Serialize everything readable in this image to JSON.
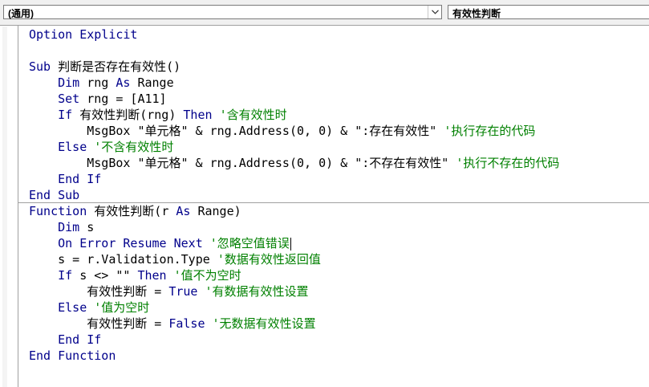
{
  "toolbar": {
    "object_combo": "(通用)",
    "procedure_combo": "有效性判断"
  },
  "code_lines": [
    [
      {
        "t": "kw",
        "v": "Option Explicit"
      }
    ],
    [],
    [
      {
        "t": "kw",
        "v": "Sub "
      },
      {
        "t": "tx",
        "v": "判断是否存在有效性()"
      }
    ],
    [
      {
        "t": "tx",
        "v": "    "
      },
      {
        "t": "kw",
        "v": "Dim "
      },
      {
        "t": "tx",
        "v": "rng "
      },
      {
        "t": "kw",
        "v": "As "
      },
      {
        "t": "tx",
        "v": "Range"
      }
    ],
    [
      {
        "t": "tx",
        "v": "    "
      },
      {
        "t": "kw",
        "v": "Set "
      },
      {
        "t": "tx",
        "v": "rng = [A11]"
      }
    ],
    [
      {
        "t": "tx",
        "v": "    "
      },
      {
        "t": "kw",
        "v": "If "
      },
      {
        "t": "tx",
        "v": "有效性判断(rng) "
      },
      {
        "t": "kw",
        "v": "Then "
      },
      {
        "t": "cm",
        "v": "'含有效性时"
      }
    ],
    [
      {
        "t": "tx",
        "v": "        MsgBox \"单元格\" & rng.Address(0, 0) & \":存在有效性\" "
      },
      {
        "t": "cm",
        "v": "'执行存在的代码"
      }
    ],
    [
      {
        "t": "tx",
        "v": "    "
      },
      {
        "t": "kw",
        "v": "Else "
      },
      {
        "t": "cm",
        "v": "'不含有效性时"
      }
    ],
    [
      {
        "t": "tx",
        "v": "        MsgBox \"单元格\" & rng.Address(0, 0) & \":不存在有效性\" "
      },
      {
        "t": "cm",
        "v": "'执行不存在的代码"
      }
    ],
    [
      {
        "t": "tx",
        "v": "    "
      },
      {
        "t": "kw",
        "v": "End If"
      }
    ],
    [
      {
        "t": "kw",
        "v": "End Sub"
      }
    ],
    [
      {
        "t": "kw",
        "v": "Function "
      },
      {
        "t": "tx",
        "v": "有效性判断(r "
      },
      {
        "t": "kw",
        "v": "As "
      },
      {
        "t": "tx",
        "v": "Range)"
      }
    ],
    [
      {
        "t": "tx",
        "v": "    "
      },
      {
        "t": "kw",
        "v": "Dim "
      },
      {
        "t": "tx",
        "v": "s"
      }
    ],
    [
      {
        "t": "tx",
        "v": "    "
      },
      {
        "t": "kw",
        "v": "On Error Resume Next "
      },
      {
        "t": "cm",
        "v": "'忽略空值错误"
      }
    ],
    [
      {
        "t": "tx",
        "v": "    s = r.Validation.Type "
      },
      {
        "t": "cm",
        "v": "'数据有效性返回值"
      }
    ],
    [
      {
        "t": "tx",
        "v": "    "
      },
      {
        "t": "kw",
        "v": "If "
      },
      {
        "t": "tx",
        "v": "s <> \"\" "
      },
      {
        "t": "kw",
        "v": "Then "
      },
      {
        "t": "cm",
        "v": "'值不为空时"
      }
    ],
    [
      {
        "t": "tx",
        "v": "        有效性判断 = "
      },
      {
        "t": "kw",
        "v": "True "
      },
      {
        "t": "cm",
        "v": "'有数据有效性设置"
      }
    ],
    [
      {
        "t": "tx",
        "v": "    "
      },
      {
        "t": "kw",
        "v": "Else "
      },
      {
        "t": "cm",
        "v": "'值为空时"
      }
    ],
    [
      {
        "t": "tx",
        "v": "        有效性判断 = "
      },
      {
        "t": "kw",
        "v": "False "
      },
      {
        "t": "cm",
        "v": "'无数据有效性设置"
      }
    ],
    [
      {
        "t": "tx",
        "v": "    "
      },
      {
        "t": "kw",
        "v": "End If"
      }
    ],
    [
      {
        "t": "kw",
        "v": "End Function"
      }
    ]
  ],
  "colors": {
    "keyword": "#00008b",
    "comment": "#008000",
    "text": "#000000"
  }
}
